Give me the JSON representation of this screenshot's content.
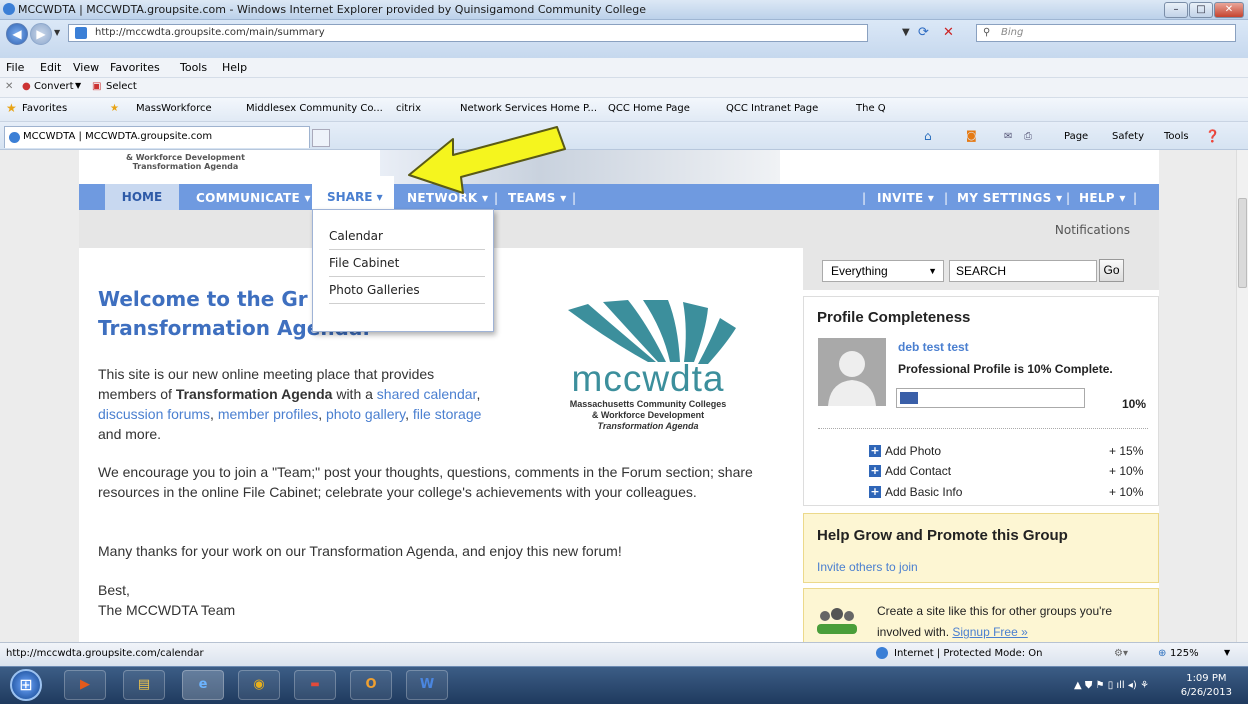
{
  "window": {
    "title": "MCCWDTA | MCCWDTA.groupsite.com - Windows Internet Explorer provided by Quinsigamond Community College"
  },
  "browser": {
    "address": "http://mccwdta.groupsite.com/main/summary",
    "search_placeholder": "Bing",
    "menu": [
      "File",
      "Edit",
      "View",
      "Favorites",
      "Tools",
      "Help"
    ],
    "convert_label": "Convert",
    "select_label": "Select",
    "favorites_label": "Favorites",
    "favorites": [
      "MassWorkforce",
      "Middlesex Community Co...",
      "citrix",
      "Network Services Home P...",
      "QCC Home Page",
      "QCC Intranet Page",
      "The Q"
    ],
    "tab_title": "MCCWDTA | MCCWDTA.groupsite.com",
    "commands": {
      "page": "Page",
      "safety": "Safety",
      "tools": "Tools"
    }
  },
  "site": {
    "logo_small_line1": "& Workforce Development",
    "logo_small_line2": "Transformation Agenda",
    "nav": {
      "home": "HOME",
      "communicate": "COMMUNICATE ▾",
      "share": "SHARE ▾",
      "network": "NETWORK ▾",
      "teams": "TEAMS ▾",
      "invite": "INVITE ▾",
      "settings": "MY SETTINGS ▾",
      "help": "HELP ▾"
    },
    "notifications": "Notifications",
    "share_menu": [
      "Calendar",
      "File Cabinet",
      "Photo Galleries"
    ],
    "welcome_title_1": "Welcome to the Gr",
    "welcome_title_2": "Transformation Age",
    "welcome_title_3": "nda.",
    "intro": {
      "p1_a": "This site is our new online meeting place that provides",
      "p1_b": "members of ",
      "p1_bold": "Transformation Agenda",
      "p1_c": " with a ",
      "link_calendar": "shared calendar",
      "comma1": ",",
      "link_forums": "discussion forums",
      "comma2": ", ",
      "link_profiles": "member profiles",
      "comma3": ", ",
      "link_gallery": "photo gallery",
      "comma4": ", ",
      "link_storage": "file storage",
      "p1_end": "and more.",
      "p2": "We encourage you to join a \"Team;\" post your thoughts, questions, comments in the Forum section; share resources in the online File Cabinet; celebrate your college's achievements with your colleagues.",
      "p3": "Many thanks for your work on our Transformation Agenda, and enjoy this new forum!",
      "sign1": "Best,",
      "sign2": "The MCCWDTA Team"
    },
    "logo": {
      "wordmark": "mccwdta",
      "line1": "Massachusetts Community Colleges",
      "line2": "& Workforce Development",
      "line3": "Transformation Agenda"
    },
    "search": {
      "scope": "Everything",
      "placeholder": "SEARCH",
      "go": "Go"
    },
    "profile": {
      "heading": "Profile Completeness",
      "name": "deb test test",
      "status": "Professional Profile is 10% Complete.",
      "percent_label": "10%",
      "percent": 0.1,
      "actions": [
        {
          "label": "Add Photo",
          "value": "+ 15%"
        },
        {
          "label": "Add Contact",
          "value": "+ 10%"
        },
        {
          "label": "Add Basic Info",
          "value": "+ 10%"
        }
      ]
    },
    "promote": {
      "heading": "Help Grow and Promote this Group",
      "link": "Invite others to join"
    },
    "create": {
      "text1": "Create a site like this for other groups you're",
      "text2": "involved with. ",
      "link": "Signup Free »"
    }
  },
  "status": {
    "url": "http://mccwdta.groupsite.com/calendar",
    "zone": "Internet | Protected Mode: On",
    "zoom": "125%"
  },
  "clock": {
    "time": "1:09 PM",
    "date": "6/26/2013"
  },
  "colors": {
    "nav": "#6f9ae0",
    "link": "#4a7fd0",
    "heading": "#3e6fbf",
    "arrow": "#f5f51e"
  }
}
